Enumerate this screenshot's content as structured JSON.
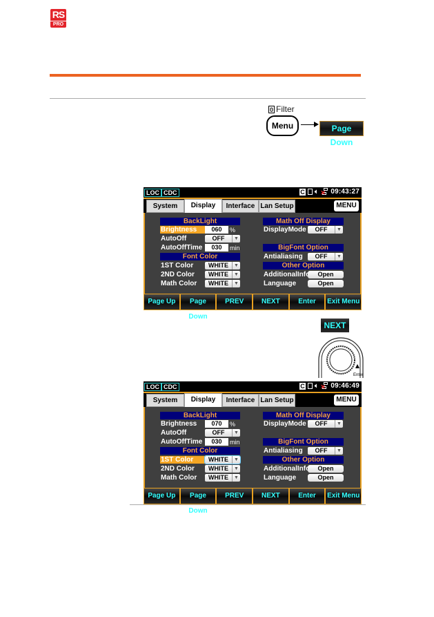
{
  "logo": {
    "brand": "RS",
    "sub": "PRO"
  },
  "instruction": {
    "filter_key": "0",
    "filter_label": "Filter",
    "menu_key": "Menu",
    "page_down_key": "Page Down",
    "next_key": "NEXT",
    "knob_label": "Enter"
  },
  "screens": [
    {
      "status": {
        "loc": "LOC",
        "cdc": "CDC",
        "c_icon": "C",
        "time": "09:43:27"
      },
      "tabs": [
        "System",
        "Display",
        "Interface",
        "Lan Setup"
      ],
      "active_tab": "Display",
      "menu_button": "MENU",
      "backlight": {
        "title": "BackLight",
        "brightness_label": "Brightness",
        "brightness_value": "060",
        "brightness_unit": "%",
        "autooff_label": "AutoOff",
        "autooff_value": "OFF",
        "autoofftime_label": "AutoOffTime",
        "autoofftime_value": "030",
        "autoofftime_unit": "min"
      },
      "font_color": {
        "title": "Font Color",
        "first_label": "1ST Color",
        "first_value": "WHITE",
        "second_label": "2ND Color",
        "second_value": "WHITE",
        "math_label": "Math Color",
        "math_value": "WHITE"
      },
      "math_off": {
        "title": "Math Off Display",
        "mode_label": "DisplayMode",
        "mode_value": "OFF"
      },
      "bigfont": {
        "title": "BigFont Option",
        "aa_label": "Antialiasing",
        "aa_value": "OFF"
      },
      "other": {
        "title": "Other Option",
        "addinfo_label": "AdditionalInfo",
        "addinfo_button": "Open",
        "lang_label": "Language",
        "lang_button": "Open"
      },
      "selected_item": "Brightness",
      "softkeys": [
        "Page Up",
        "Page Down",
        "PREV",
        "NEXT",
        "Enter",
        "Exit Menu"
      ]
    },
    {
      "status": {
        "loc": "LOC",
        "cdc": "CDC",
        "c_icon": "C",
        "time": "09:46:49"
      },
      "tabs": [
        "System",
        "Display",
        "Interface",
        "Lan Setup"
      ],
      "active_tab": "Display",
      "menu_button": "MENU",
      "backlight": {
        "title": "BackLight",
        "brightness_label": "Brightness",
        "brightness_value": "070",
        "brightness_unit": "%",
        "autooff_label": "AutoOff",
        "autooff_value": "OFF",
        "autoofftime_label": "AutoOffTime",
        "autoofftime_value": "030",
        "autoofftime_unit": "min"
      },
      "font_color": {
        "title": "Font Color",
        "first_label": "1ST Color",
        "first_value": "WHITE",
        "second_label": "2ND Color",
        "second_value": "WHITE",
        "math_label": "Math Color",
        "math_value": "WHITE"
      },
      "math_off": {
        "title": "Math Off Display",
        "mode_label": "DisplayMode",
        "mode_value": "OFF"
      },
      "bigfont": {
        "title": "BigFont Option",
        "aa_label": "Antialiasing",
        "aa_value": "OFF"
      },
      "other": {
        "title": "Other Option",
        "addinfo_label": "AdditionalInfo",
        "addinfo_button": "Open",
        "lang_label": "Language",
        "lang_button": "Open"
      },
      "selected_item": "1ST Color",
      "softkeys": [
        "Page Up",
        "Page Down",
        "PREV",
        "NEXT",
        "Enter",
        "Exit Menu"
      ]
    }
  ],
  "colors": {
    "accent_orange": "#ec6322",
    "screen_border": "#e8a020",
    "header_blue": "#00007a",
    "softkey_text": "#33ffff",
    "selection": "#f5a623"
  }
}
